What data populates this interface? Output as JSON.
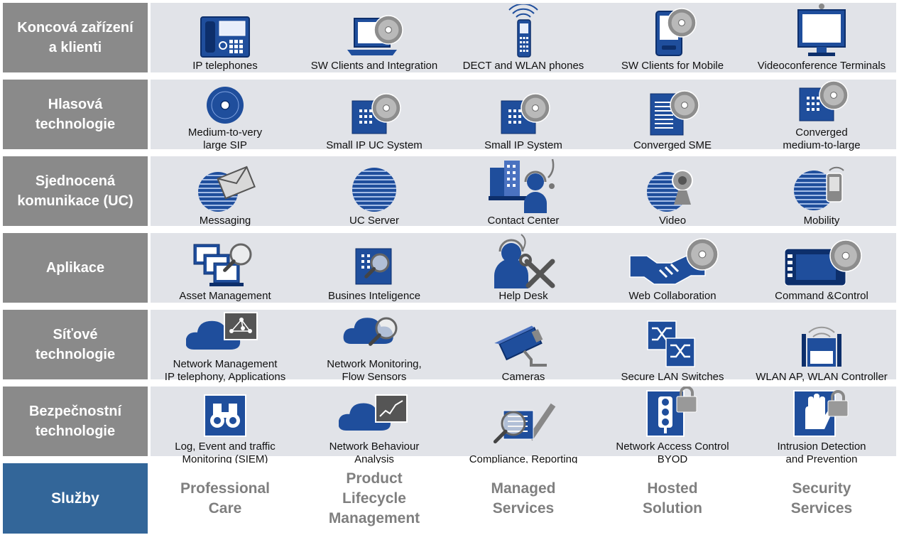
{
  "rows": [
    {
      "label": "Koncová zařízení\na klienti",
      "items": [
        {
          "label": "IP telephones",
          "icon": "ip-phone-icon"
        },
        {
          "label": "SW Clients and  Integration",
          "icon": "laptop-disc-icon"
        },
        {
          "label": "DECT and WLAN phones",
          "icon": "dect-phone-icon"
        },
        {
          "label": "SW  Clients for  Mobile",
          "icon": "mobile-disc-icon"
        },
        {
          "label": "Videoconference Terminals",
          "icon": "video-terminal-icon"
        }
      ]
    },
    {
      "label": "Hlasová\ntechnologie",
      "items": [
        {
          "label": "Medium-to-very\nlarge SIP",
          "icon": "disc-icon"
        },
        {
          "label": "Small IP UC System",
          "icon": "server-disc-icon"
        },
        {
          "label": "Small IP System",
          "icon": "server-disc-icon"
        },
        {
          "label": "Converged SME",
          "icon": "document-disc-icon"
        },
        {
          "label": "Converged\nmedium-to-large",
          "icon": "server-disc-icon"
        }
      ]
    },
    {
      "label": "Sjednocená\nkomunikace (UC)",
      "items": [
        {
          "label": "Messaging",
          "icon": "globe-envelope-icon"
        },
        {
          "label": "UC Server",
          "icon": "globe-icon"
        },
        {
          "label": "Contact Center",
          "icon": "agent-headset-icon"
        },
        {
          "label": "Video",
          "icon": "globe-webcam-icon"
        },
        {
          "label": "Mobility",
          "icon": "globe-phone-icon"
        }
      ]
    },
    {
      "label": "Aplikace",
      "items": [
        {
          "label": "Asset Management",
          "icon": "computers-magnifier-icon"
        },
        {
          "label": "Busines Inteligence",
          "icon": "box-magnifier-icon"
        },
        {
          "label": "Help Desk",
          "icon": "headset-tools-icon"
        },
        {
          "label": "Web Collaboration",
          "icon": "handshake-disc-icon"
        },
        {
          "label": "Command &Control",
          "icon": "control-panel-disc-icon"
        }
      ]
    },
    {
      "label": "Síťové\ntechnologie",
      "items": [
        {
          "label": "Network Management\nIP telephony, Applications",
          "icon": "cloud-network-icon"
        },
        {
          "label": "Network Monitoring,\nFlow Sensors",
          "icon": "cloud-magnifier-icon"
        },
        {
          "label": "Cameras",
          "icon": "camera-icon"
        },
        {
          "label": "Secure LAN Switches",
          "icon": "switch-icon"
        },
        {
          "label": "WLAN AP, WLAN Controller",
          "icon": "wlan-ap-icon"
        }
      ]
    },
    {
      "label": "Bezpečnostní\ntechnologie",
      "items": [
        {
          "label": "Log, Event and traffic\nMonitoring (SIEM)",
          "icon": "binoculars-icon"
        },
        {
          "label": "Network Behaviour\nAnalysis",
          "icon": "cloud-chart-icon"
        },
        {
          "label": "Compliance, Reporting",
          "icon": "checklist-magnifier-icon"
        },
        {
          "label": "Network Access Control\nBYOD",
          "icon": "traffic-light-lock-icon"
        },
        {
          "label": "Intrusion Detection\nand Prevention",
          "icon": "hand-lock-icon"
        }
      ]
    }
  ],
  "services": {
    "label": "Služby",
    "items": [
      "Professional\nCare",
      "Product\nLifecycle\nManagement",
      "Managed\nServices",
      "Hosted\nSolution",
      "Security\nServices"
    ]
  },
  "colors": {
    "row_label_bg": "#8a8a8a",
    "row_body_bg": "#e1e3e8",
    "services_label_bg": "#336699",
    "service_text": "#7f7f7f",
    "icon_blue": "#1f4e9c",
    "icon_dark": "#0d2f6b",
    "disc_gray": "#8d8d8d"
  }
}
